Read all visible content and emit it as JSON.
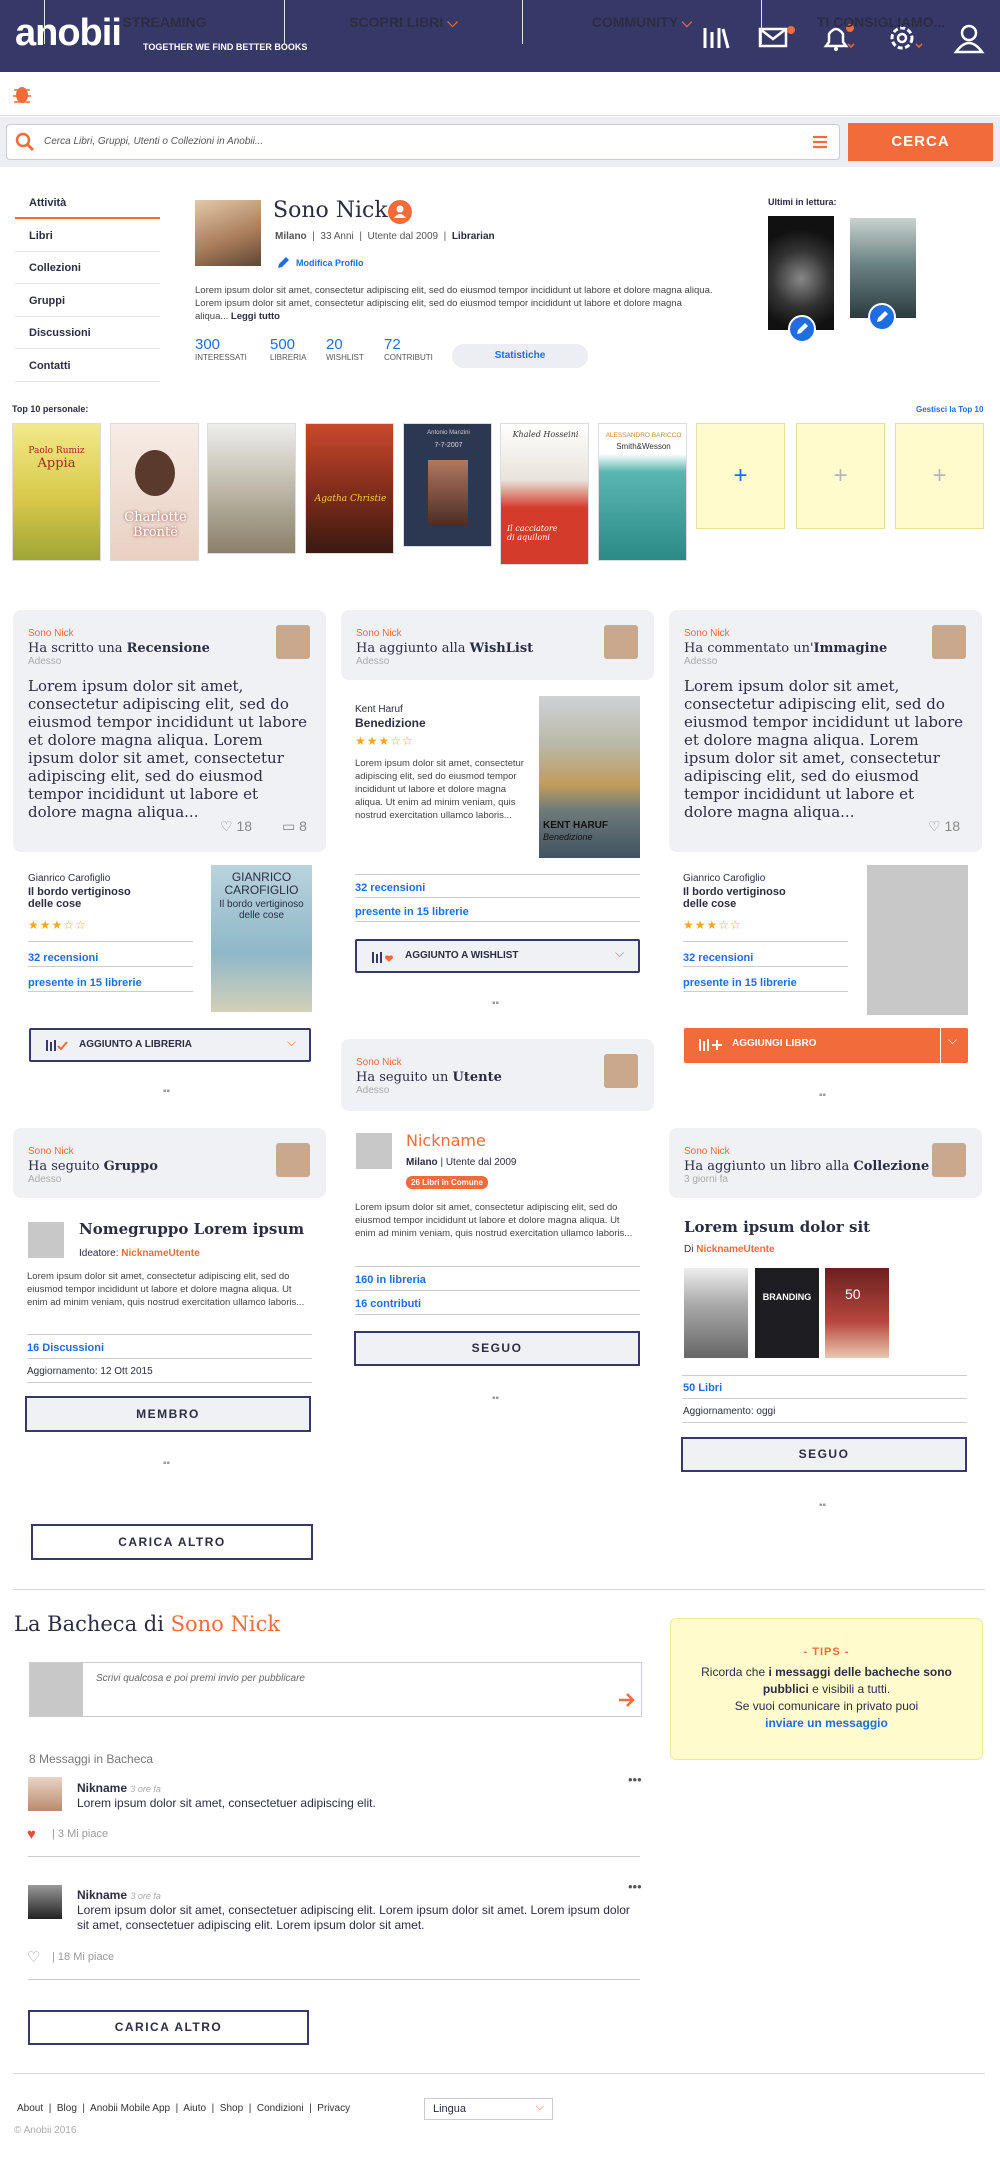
{
  "brand": {
    "logo": "anobii",
    "tagline": "TOGETHER WE FIND BETTER BOOKS"
  },
  "nav": {
    "items": [
      "STREAMING",
      "SCOPRI LIBRI",
      "COMMUNITY",
      "TI CONSIGLIAMO..."
    ]
  },
  "search": {
    "placeholder": "Cerca Libri, Gruppi, Utenti o Collezioni in Anobii...",
    "button": "CERCA"
  },
  "sidebar": {
    "items": [
      "Attività",
      "Libri",
      "Collezioni",
      "Gruppi",
      "Discussioni",
      "Contatti"
    ]
  },
  "profile": {
    "name": "Sono Nick",
    "city": "Milano",
    "age": "33 Anni",
    "since": "Utente dal 2009",
    "role": "Librarian",
    "edit": "Modifica Profilo",
    "bio": "Lorem ipsum dolor sit amet, consectetur adipiscing elit, sed do eiusmod tempor incididunt ut labore et dolore magna aliqua. Lorem ipsum dolor sit amet, consectetur adipiscing elit, sed do eiusmod tempor incididunt ut labore et dolore magna aliqua...",
    "more": "Leggi tutto",
    "stats": [
      {
        "value": "300",
        "label": "INTERESSATI"
      },
      {
        "value": "500",
        "label": "LIBRERIA"
      },
      {
        "value": "20",
        "label": "WISHLIST"
      },
      {
        "value": "72",
        "label": "CONTRIBUTI"
      }
    ],
    "stats_button": "Statistiche",
    "reading_label": "Ultimi in lettura:"
  },
  "top10": {
    "label": "Top 10 personale:",
    "manage": "Gestisci la Top 10",
    "books": [
      {
        "author": "Paolo Rumiz",
        "title": "Appia"
      },
      {
        "author": "",
        "title": "Charlotte Brontë"
      },
      {
        "author": "",
        "title": ""
      },
      {
        "author": "Agatha Christie",
        "title": ""
      },
      {
        "author": "Antonio Manzini",
        "title": "7-7-2007"
      },
      {
        "author": "Khaled Hosseini",
        "title": "Il cacciatore di aquiloni"
      },
      {
        "author": "ALESSANDRO BARICCO",
        "title": "Smith&Wesson"
      }
    ],
    "add": "+"
  },
  "feed": {
    "c1": {
      "who": "Sono Nick",
      "pre": "Ha scritto una ",
      "obj": "Recensione",
      "when": "Adesso",
      "text": "Lorem ipsum dolor sit amet, consectetur adipiscing elit, sed do eiusmod tempor incididunt ut labore et dolore magna aliqua. Lorem ipsum dolor sit amet, consectetur adipiscing elit, sed do eiusmod tempor incididunt ut labore et dolore magna aliqua...",
      "likes": "18",
      "comments": "8",
      "author": "Gianrico Carofiglio",
      "title": "Il bordo vertiginoso delle cose",
      "reviews": "32 recensioni",
      "stores": "presente in 15 librerie",
      "btn": "AGGIUNTO A LIBRERIA",
      "cover_author": "GIANRICO CAROFIGLIO",
      "cover_title": "Il bordo vertiginoso delle cose"
    },
    "c2": {
      "who": "Sono Nick",
      "pre": "Ha aggiunto alla ",
      "obj": "WishList",
      "when": "Adesso",
      "author": "Kent Haruf",
      "title": "Benedizione",
      "text": "Lorem ipsum dolor sit amet, consectetur adipiscing elit, sed do eiusmod tempor incididunt ut labore et dolore magna aliqua. Ut enim ad minim veniam, quis nostrud exercitation ullamco laboris...",
      "reviews": "32 recensioni",
      "stores": "presente in 15 librerie",
      "btn": "AGGIUNTO A WISHLIST",
      "cover_author": "KENT HARUF",
      "cover_title": "Benedizione"
    },
    "c3": {
      "who": "Sono Nick",
      "pre": "Ha commentato un'",
      "obj": "Immagine",
      "when": "Adesso",
      "text": "Lorem ipsum dolor sit amet, consectetur adipiscing elit, sed do eiusmod tempor incididunt ut labore et dolore magna aliqua. Lorem ipsum dolor sit amet, consectetur adipiscing elit, sed do eiusmod tempor incididunt ut labore et dolore magna aliqua...",
      "likes": "18",
      "author": "Gianrico Carofiglio",
      "title": "Il bordo vertiginoso delle cose",
      "reviews": "32 recensioni",
      "stores": "presente in 15 librerie",
      "btn": "AGGIUNGI LIBRO"
    },
    "c4": {
      "who": "Sono Nick",
      "pre": "Ha seguito un ",
      "obj": "Utente",
      "when": "Adesso",
      "nick": "Nickname",
      "city": "Milano",
      "since": "Utente dal 2009",
      "common": "26 Libri in Comune",
      "text": "Lorem ipsum dolor sit amet, consectetur adipiscing elit, sed do eiusmod tempor incididunt ut labore et dolore magna aliqua. Ut enim ad minim veniam, quis nostrud exercitation ullamco laboris...",
      "books": "160 in libreria",
      "contrib": "16 contributi",
      "btn": "SEGUO"
    },
    "c5": {
      "who": "Sono Nick",
      "pre": "Ha seguito  ",
      "obj": "Gruppo",
      "when": "Adesso",
      "group": "Nomegruppo Lorem ipsum",
      "creator_label": "Ideatore: ",
      "creator": "NicknameUtente",
      "text": "Lorem ipsum dolor sit amet, consectetur adipiscing elit, sed do eiusmod tempor incididunt ut labore et dolore magna aliqua. Ut enim ad minim veniam, quis nostrud exercitation ullamco laboris...",
      "disc": "16 Discussioni",
      "update": "Aggiornamento: 12 Ott 2015",
      "btn": "MEMBRO"
    },
    "c6": {
      "who": "Sono Nick",
      "pre": "Ha aggiunto un libro alla ",
      "obj": "Collezione",
      "when": "3 giorni fa",
      "coll": "Lorem ipsum dolor sit",
      "by": "Di ",
      "byname": "NicknameUtente",
      "books": "50 Libri",
      "update": "Aggiornamento: oggi",
      "btn": "SEGUO",
      "cover2": "BRANDING",
      "cover3": "50"
    },
    "load_more": "CARICA ALTRO"
  },
  "board": {
    "title_pre": "La Bacheca di ",
    "title_name": "Sono Nick",
    "placeholder": "Scrivi qualcosa e poi premi invio per pubblicare",
    "count": "8 Messaggi in Bacheca",
    "posts": [
      {
        "name": "Nikname",
        "time": "3 ore fa",
        "text": "Lorem ipsum dolor sit amet, consectetuer adipiscing elit.",
        "likes": "3 Mi piace"
      },
      {
        "name": "Nikname",
        "time": "3 ore fa",
        "text": "Lorem ipsum dolor sit amet, consectetuer adipiscing elit. Lorem ipsum dolor sit amet. Lorem ipsum dolor sit amet, consectetuer adipiscing elit. Lorem ipsum dolor sit amet.",
        "likes": "18  Mi piace"
      }
    ],
    "load_more": "CARICA ALTRO"
  },
  "tips": {
    "title": "- TIPS -",
    "pre": "Ricorda che ",
    "bold": "i messaggi delle bacheche sono pubblici",
    "post": " e visibili a tutti.",
    "line2": "Se vuoi comunicare in privato puoi",
    "link": "inviare un messaggio"
  },
  "footer": {
    "links": [
      "About",
      "Blog",
      "Anobii Mobile App",
      "Aiuto",
      "Shop",
      "Condizioni",
      "Privacy"
    ],
    "lang": "Lingua",
    "copy": "© Anobii 2016"
  },
  "colors": {
    "brand": "#363867",
    "accent": "#f26b3a",
    "link": "#1f6de0"
  }
}
